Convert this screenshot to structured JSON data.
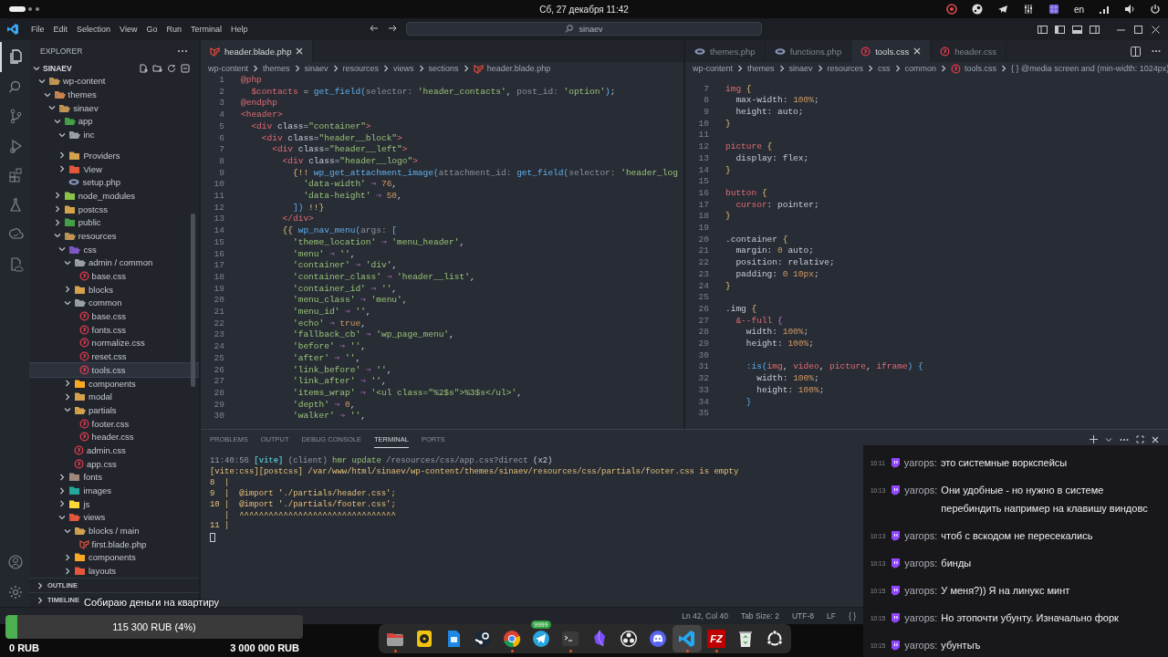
{
  "system_bar": {
    "clock": "Сб, 27 декабря 11:42",
    "keyboard_layout": "en"
  },
  "window": {
    "menu": [
      "File",
      "Edit",
      "Selection",
      "View",
      "Go",
      "Run",
      "Terminal",
      "Help"
    ],
    "command_center": "sinaev"
  },
  "activity_bar": [
    {
      "kind": "explorer",
      "selected": true
    },
    {
      "kind": "search",
      "selected": false
    },
    {
      "kind": "scm",
      "selected": false
    },
    {
      "kind": "debug",
      "selected": false
    },
    {
      "kind": "extensions",
      "selected": false
    },
    {
      "kind": "testing",
      "selected": false
    },
    {
      "kind": "remote",
      "selected": false
    },
    {
      "kind": "docker",
      "selected": false
    },
    {
      "kind": "account",
      "selected": false
    },
    {
      "kind": "settings",
      "selected": false
    }
  ],
  "explorer": {
    "title": "EXPLORER",
    "workspace": "SINAEV",
    "tree": [
      {
        "label": "wp-content",
        "kind": "folder",
        "color": "#c09553",
        "expanded": true,
        "selected": false,
        "children": [
          {
            "label": "themes",
            "kind": "folder",
            "color": "#c9834f",
            "expanded": true,
            "selected": false,
            "children": [
              {
                "label": "sinaev",
                "kind": "folder",
                "color": "#c09553",
                "expanded": true,
                "selected": false,
                "children": [
                  {
                    "label": "app",
                    "kind": "folder",
                    "color": "#43a047",
                    "expanded": true,
                    "selected": false,
                    "children": [
                      {
                        "label": "inc",
                        "kind": "folder",
                        "color": "#9aa0a6",
                        "expanded": true,
                        "selected": false
                      },
                      {
                        "label": "Providers",
                        "kind": "folder",
                        "color": "#d4a24c",
                        "expanded": false,
                        "selected": false
                      },
                      {
                        "label": "View",
                        "kind": "folder",
                        "color": "#e4573d",
                        "expanded": false,
                        "selected": false
                      },
                      {
                        "label": "setup.php",
                        "kind": "php",
                        "selected": false
                      }
                    ]
                  },
                  {
                    "label": "node_modules",
                    "kind": "folder",
                    "color": "#8bc34a",
                    "expanded": false,
                    "selected": false
                  },
                  {
                    "label": "postcss",
                    "kind": "folder",
                    "color": "#d4a24c",
                    "expanded": false,
                    "selected": false
                  },
                  {
                    "label": "public",
                    "kind": "folder",
                    "color": "#43a047",
                    "expanded": false,
                    "selected": false
                  },
                  {
                    "label": "resources",
                    "kind": "folder",
                    "color": "#c09553",
                    "expanded": true,
                    "selected": false,
                    "children": [
                      {
                        "label": "css",
                        "kind": "folder",
                        "color": "#7e57c2",
                        "expanded": true,
                        "selected": false,
                        "children": [
                          {
                            "label": "admin / common",
                            "kind": "folder",
                            "color": "#9aa0a6",
                            "expanded": true,
                            "selected": false,
                            "children": [
                              {
                                "label": "base.css",
                                "kind": "css",
                                "selected": false
                              }
                            ]
                          },
                          {
                            "label": "blocks",
                            "kind": "folder",
                            "color": "#d4a24c",
                            "expanded": false,
                            "selected": false
                          },
                          {
                            "label": "common",
                            "kind": "folder",
                            "color": "#9aa0a6",
                            "expanded": true,
                            "selected": false,
                            "children": [
                              {
                                "label": "base.css",
                                "kind": "css",
                                "selected": false
                              },
                              {
                                "label": "fonts.css",
                                "kind": "css",
                                "selected": false
                              },
                              {
                                "label": "normalize.css",
                                "kind": "css",
                                "selected": false
                              },
                              {
                                "label": "reset.css",
                                "kind": "css",
                                "selected": false
                              },
                              {
                                "label": "tools.css",
                                "kind": "css",
                                "selected": true
                              }
                            ]
                          },
                          {
                            "label": "components",
                            "kind": "folder",
                            "color": "#f9a825",
                            "expanded": false,
                            "selected": false
                          },
                          {
                            "label": "modal",
                            "kind": "folder",
                            "color": "#d4a24c",
                            "expanded": false,
                            "selected": false
                          },
                          {
                            "label": "partials",
                            "kind": "folder",
                            "color": "#d4a24c",
                            "expanded": true,
                            "selected": false,
                            "children": [
                              {
                                "label": "footer.css",
                                "kind": "css",
                                "selected": false
                              },
                              {
                                "label": "header.css",
                                "kind": "css",
                                "selected": false
                              }
                            ]
                          },
                          {
                            "label": "admin.css",
                            "kind": "css",
                            "selected": false
                          },
                          {
                            "label": "app.css",
                            "kind": "css",
                            "selected": false
                          }
                        ]
                      },
                      {
                        "label": "fonts",
                        "kind": "folder",
                        "color": "#a1887f",
                        "expanded": false,
                        "selected": false
                      },
                      {
                        "label": "images",
                        "kind": "folder",
                        "color": "#26a69a",
                        "expanded": false,
                        "selected": false
                      },
                      {
                        "label": "js",
                        "kind": "folder",
                        "color": "#fdd835",
                        "expanded": false,
                        "selected": false
                      },
                      {
                        "label": "views",
                        "kind": "folder",
                        "color": "#e4573d",
                        "expanded": true,
                        "selected": false,
                        "children": [
                          {
                            "label": "blocks / main",
                            "kind": "folder",
                            "color": "#d4a24c",
                            "expanded": true,
                            "selected": false,
                            "children": [
                              {
                                "label": "first.blade.php",
                                "kind": "blade",
                                "selected": false
                              }
                            ]
                          },
                          {
                            "label": "components",
                            "kind": "folder",
                            "color": "#f9a825",
                            "expanded": false,
                            "selected": false
                          },
                          {
                            "label": "layouts",
                            "kind": "folder",
                            "color": "#e4573d",
                            "expanded": false,
                            "selected": false
                          }
                        ]
                      }
                    ]
                  }
                ]
              }
            ]
          }
        ]
      }
    ],
    "sections": [
      {
        "label": "OUTLINE",
        "expanded": false
      },
      {
        "label": "TIMELINE",
        "expanded": false
      }
    ]
  },
  "editors": [
    {
      "tabs": [
        {
          "label": "header.blade.php",
          "kind": "blade",
          "selected": true
        }
      ],
      "breadcrumbs": [
        {
          "label": "wp-content",
          "kind": "dir"
        },
        {
          "label": "themes",
          "kind": "dir"
        },
        {
          "label": "sinaev",
          "kind": "dir"
        },
        {
          "label": "resources",
          "kind": "dir"
        },
        {
          "label": "views",
          "kind": "dir"
        },
        {
          "label": "sections",
          "kind": "dir"
        },
        {
          "label": "header.blade.php",
          "kind": "blade"
        }
      ],
      "lines": [
        {
          "n": "1",
          "tokens": [
            {
              "kind": "keyword",
              "text": "@php"
            }
          ]
        },
        {
          "n": "2",
          "tokens": [
            {
              "kind": "keyword",
              "text": "  $contacts"
            },
            {
              "kind": "plain",
              "text": " = "
            },
            {
              "kind": "call",
              "text": "get_field("
            },
            {
              "kind": "hint",
              "text": "selector: "
            },
            {
              "kind": "string",
              "text": "'header_contacts'"
            },
            {
              "kind": "plain",
              "text": ", "
            },
            {
              "kind": "hint",
              "text": "post_id: "
            },
            {
              "kind": "string",
              "text": "'option'"
            },
            {
              "kind": "call",
              "text": ")"
            },
            {
              "kind": "plain",
              "text": ";"
            }
          ]
        },
        {
          "n": "3",
          "tokens": [
            {
              "kind": "keyword",
              "text": "@endphp"
            }
          ]
        },
        {
          "n": "4",
          "tokens": [
            {
              "kind": "keyword",
              "text": "<header>"
            }
          ]
        },
        {
          "n": "5",
          "tokens": [
            {
              "kind": "keyword",
              "text": "  <div "
            },
            {
              "kind": "plain",
              "text": "class="
            },
            {
              "kind": "string",
              "text": "\"container\""
            },
            {
              "kind": "keyword",
              "text": ">"
            }
          ]
        },
        {
          "n": "6",
          "tokens": [
            {
              "kind": "keyword",
              "text": "    <div "
            },
            {
              "kind": "plain",
              "text": "class="
            },
            {
              "kind": "string",
              "text": "\"header__block\""
            },
            {
              "kind": "keyword",
              "text": ">"
            }
          ]
        },
        {
          "n": "7",
          "tokens": [
            {
              "kind": "keyword",
              "text": "      <div "
            },
            {
              "kind": "plain",
              "text": "class="
            },
            {
              "kind": "string",
              "text": "\"header__left\""
            },
            {
              "kind": "keyword",
              "text": ">"
            }
          ]
        },
        {
          "n": "8",
          "tokens": [
            {
              "kind": "keyword",
              "text": "        <div "
            },
            {
              "kind": "plain",
              "text": "class="
            },
            {
              "kind": "string",
              "text": "\"header__logo\""
            },
            {
              "kind": "keyword",
              "text": ">"
            }
          ]
        },
        {
          "n": "9",
          "tokens": [
            {
              "kind": "brace",
              "text": "          {!! "
            },
            {
              "kind": "call",
              "text": "wp_get_attachment_image("
            },
            {
              "kind": "hint",
              "text": "attachment_id: "
            },
            {
              "kind": "call",
              "text": "get_field("
            },
            {
              "kind": "hint",
              "text": "selector: "
            },
            {
              "kind": "string",
              "text": "'header_log"
            }
          ]
        },
        {
          "n": "10",
          "tokens": [
            {
              "kind": "string",
              "text": "            'data-width'"
            },
            {
              "kind": "operator",
              "text": " ⇒ "
            },
            {
              "kind": "number",
              "text": "76"
            },
            {
              "kind": "plain",
              "text": ","
            }
          ]
        },
        {
          "n": "11",
          "tokens": [
            {
              "kind": "string",
              "text": "            'data-height'"
            },
            {
              "kind": "operator",
              "text": " ⇒ "
            },
            {
              "kind": "number",
              "text": "50"
            },
            {
              "kind": "plain",
              "text": ","
            }
          ]
        },
        {
          "n": "12",
          "tokens": [
            {
              "kind": "call",
              "text": "          ])"
            },
            {
              "kind": "brace",
              "text": " !!}"
            }
          ]
        },
        {
          "n": "13",
          "tokens": [
            {
              "kind": "keyword",
              "text": "        </div>"
            }
          ]
        },
        {
          "n": "14",
          "tokens": [
            {
              "kind": "brace",
              "text": "        {{ "
            },
            {
              "kind": "call",
              "text": "wp_nav_menu("
            },
            {
              "kind": "hint",
              "text": "args: "
            },
            {
              "kind": "call",
              "text": "["
            }
          ]
        },
        {
          "n": "15",
          "tokens": [
            {
              "kind": "string",
              "text": "          'theme_location'"
            },
            {
              "kind": "operator",
              "text": " ⇒ "
            },
            {
              "kind": "string",
              "text": "'menu_header'"
            },
            {
              "kind": "plain",
              "text": ","
            }
          ]
        },
        {
          "n": "16",
          "tokens": [
            {
              "kind": "string",
              "text": "          'menu'"
            },
            {
              "kind": "operator",
              "text": " ⇒ "
            },
            {
              "kind": "string",
              "text": "''"
            },
            {
              "kind": "plain",
              "text": ","
            }
          ]
        },
        {
          "n": "17",
          "tokens": [
            {
              "kind": "string",
              "text": "          'container'"
            },
            {
              "kind": "operator",
              "text": " ⇒ "
            },
            {
              "kind": "string",
              "text": "'div'"
            },
            {
              "kind": "plain",
              "text": ","
            }
          ]
        },
        {
          "n": "18",
          "tokens": [
            {
              "kind": "string",
              "text": "          'container_class'"
            },
            {
              "kind": "operator",
              "text": " ⇒ "
            },
            {
              "kind": "string",
              "text": "'header__list'"
            },
            {
              "kind": "plain",
              "text": ","
            }
          ]
        },
        {
          "n": "19",
          "tokens": [
            {
              "kind": "string",
              "text": "          'container_id'"
            },
            {
              "kind": "operator",
              "text": " ⇒ "
            },
            {
              "kind": "string",
              "text": "''"
            },
            {
              "kind": "plain",
              "text": ","
            }
          ]
        },
        {
          "n": "20",
          "tokens": [
            {
              "kind": "string",
              "text": "          'menu_class'"
            },
            {
              "kind": "operator",
              "text": " ⇒ "
            },
            {
              "kind": "string",
              "text": "'menu'"
            },
            {
              "kind": "plain",
              "text": ","
            }
          ]
        },
        {
          "n": "21",
          "tokens": [
            {
              "kind": "string",
              "text": "          'menu_id'"
            },
            {
              "kind": "operator",
              "text": " ⇒ "
            },
            {
              "kind": "string",
              "text": "''"
            },
            {
              "kind": "plain",
              "text": ","
            }
          ]
        },
        {
          "n": "22",
          "tokens": [
            {
              "kind": "string",
              "text": "          'echo'"
            },
            {
              "kind": "operator",
              "text": " ⇒ "
            },
            {
              "kind": "number",
              "text": "true"
            },
            {
              "kind": "plain",
              "text": ","
            }
          ]
        },
        {
          "n": "23",
          "tokens": [
            {
              "kind": "string",
              "text": "          'fallback_cb'"
            },
            {
              "kind": "operator",
              "text": " ⇒ "
            },
            {
              "kind": "string",
              "text": "'wp_page_menu'"
            },
            {
              "kind": "plain",
              "text": ","
            }
          ]
        },
        {
          "n": "24",
          "tokens": [
            {
              "kind": "string",
              "text": "          'before'"
            },
            {
              "kind": "operator",
              "text": " ⇒ "
            },
            {
              "kind": "string",
              "text": "''"
            },
            {
              "kind": "plain",
              "text": ","
            }
          ]
        },
        {
          "n": "25",
          "tokens": [
            {
              "kind": "string",
              "text": "          'after'"
            },
            {
              "kind": "operator",
              "text": " ⇒ "
            },
            {
              "kind": "string",
              "text": "''"
            },
            {
              "kind": "plain",
              "text": ","
            }
          ]
        },
        {
          "n": "26",
          "tokens": [
            {
              "kind": "string",
              "text": "          'link_before'"
            },
            {
              "kind": "operator",
              "text": " ⇒ "
            },
            {
              "kind": "string",
              "text": "''"
            },
            {
              "kind": "plain",
              "text": ","
            }
          ]
        },
        {
          "n": "27",
          "tokens": [
            {
              "kind": "string",
              "text": "          'link_after'"
            },
            {
              "kind": "operator",
              "text": " ⇒ "
            },
            {
              "kind": "string",
              "text": "''"
            },
            {
              "kind": "plain",
              "text": ","
            }
          ]
        },
        {
          "n": "28",
          "tokens": [
            {
              "kind": "string",
              "text": "          'items_wrap'"
            },
            {
              "kind": "operator",
              "text": " ⇒ "
            },
            {
              "kind": "string",
              "text": "'<ul class=\"%2$s\">%3$s</ul>'"
            },
            {
              "kind": "plain",
              "text": ","
            }
          ]
        },
        {
          "n": "29",
          "tokens": [
            {
              "kind": "string",
              "text": "          'depth'"
            },
            {
              "kind": "operator",
              "text": " ⇒ "
            },
            {
              "kind": "number",
              "text": "0"
            },
            {
              "kind": "plain",
              "text": ","
            }
          ]
        },
        {
          "n": "30",
          "tokens": [
            {
              "kind": "string",
              "text": "          'walker'"
            },
            {
              "kind": "operator",
              "text": " ⇒ "
            },
            {
              "kind": "string",
              "text": "''"
            },
            {
              "kind": "plain",
              "text": ","
            }
          ]
        }
      ]
    },
    {
      "tabs": [
        {
          "label": "themes.php",
          "kind": "php",
          "selected": false
        },
        {
          "label": "functions.php",
          "kind": "php",
          "selected": false
        },
        {
          "label": "tools.css",
          "kind": "css",
          "selected": true
        },
        {
          "label": "header.css",
          "kind": "css",
          "selected": false
        }
      ],
      "breadcrumbs": [
        {
          "label": "wp-content",
          "kind": "dir"
        },
        {
          "label": "themes",
          "kind": "dir"
        },
        {
          "label": "sinaev",
          "kind": "dir"
        },
        {
          "label": "resources",
          "kind": "dir"
        },
        {
          "label": "css",
          "kind": "dir"
        },
        {
          "label": "common",
          "kind": "dir"
        },
        {
          "label": "tools.css",
          "kind": "css"
        },
        {
          "label": "{ } @media screen and (min-width: 1024px)",
          "kind": "symbol"
        }
      ],
      "lines": [
        {
          "n": "7",
          "tokens": [
            {
              "kind": "keyword",
              "text": "img "
            },
            {
              "kind": "brace",
              "text": "{"
            }
          ]
        },
        {
          "n": "8",
          "tokens": [
            {
              "kind": "plain",
              "text": "  max-width: "
            },
            {
              "kind": "number",
              "text": "100%"
            },
            {
              "kind": "plain",
              "text": ";"
            }
          ]
        },
        {
          "n": "9",
          "tokens": [
            {
              "kind": "plain",
              "text": "  height: auto;"
            }
          ]
        },
        {
          "n": "10",
          "tokens": [
            {
              "kind": "brace",
              "text": "}"
            }
          ]
        },
        {
          "n": "11"
        },
        {
          "n": "12",
          "tokens": [
            {
              "kind": "keyword",
              "text": "picture "
            },
            {
              "kind": "brace",
              "text": "{"
            }
          ]
        },
        {
          "n": "13",
          "tokens": [
            {
              "kind": "plain",
              "text": "  display: flex;"
            }
          ]
        },
        {
          "n": "14",
          "tokens": [
            {
              "kind": "brace",
              "text": "}"
            }
          ]
        },
        {
          "n": "15"
        },
        {
          "n": "16",
          "tokens": [
            {
              "kind": "keyword",
              "text": "button "
            },
            {
              "kind": "brace",
              "text": "{"
            }
          ]
        },
        {
          "n": "17",
          "tokens": [
            {
              "kind": "keyword",
              "text": "  cursor"
            },
            {
              "kind": "plain",
              "text": ": pointer;"
            }
          ]
        },
        {
          "n": "18",
          "tokens": [
            {
              "kind": "brace",
              "text": "}"
            }
          ]
        },
        {
          "n": "19"
        },
        {
          "n": "20",
          "tokens": [
            {
              "kind": "plain",
              "text": ".container "
            },
            {
              "kind": "brace",
              "text": "{"
            }
          ]
        },
        {
          "n": "21",
          "tokens": [
            {
              "kind": "plain",
              "text": "  margin: "
            },
            {
              "kind": "number",
              "text": "0"
            },
            {
              "kind": "plain",
              "text": " auto;"
            }
          ]
        },
        {
          "n": "22",
          "tokens": [
            {
              "kind": "plain",
              "text": "  position: relative;"
            }
          ]
        },
        {
          "n": "23",
          "tokens": [
            {
              "kind": "plain",
              "text": "  padding: "
            },
            {
              "kind": "number",
              "text": "0 10px"
            },
            {
              "kind": "plain",
              "text": ";"
            }
          ]
        },
        {
          "n": "24",
          "tokens": [
            {
              "kind": "brace",
              "text": "}"
            }
          ]
        },
        {
          "n": "25"
        },
        {
          "n": "26",
          "tokens": [
            {
              "kind": "plain",
              "text": ".img "
            },
            {
              "kind": "brace",
              "text": "{"
            }
          ]
        },
        {
          "n": "27",
          "tokens": [
            {
              "kind": "keyword",
              "text": "  &--full "
            },
            {
              "kind": "operator",
              "text": "{"
            }
          ]
        },
        {
          "n": "28",
          "tokens": [
            {
              "kind": "plain",
              "text": "    width: "
            },
            {
              "kind": "number",
              "text": "100%"
            },
            {
              "kind": "plain",
              "text": ";"
            }
          ]
        },
        {
          "n": "29",
          "tokens": [
            {
              "kind": "plain",
              "text": "    height: "
            },
            {
              "kind": "number",
              "text": "100%"
            },
            {
              "kind": "plain",
              "text": ";"
            }
          ]
        },
        {
          "n": "30"
        },
        {
          "n": "31",
          "tokens": [
            {
              "kind": "call",
              "text": "    :is("
            },
            {
              "kind": "keyword",
              "text": "img"
            },
            {
              "kind": "plain",
              "text": ", "
            },
            {
              "kind": "keyword",
              "text": "video"
            },
            {
              "kind": "plain",
              "text": ", "
            },
            {
              "kind": "keyword",
              "text": "picture"
            },
            {
              "kind": "plain",
              "text": ", "
            },
            {
              "kind": "keyword",
              "text": "iframe"
            },
            {
              "kind": "call",
              "text": ") {"
            }
          ]
        },
        {
          "n": "32",
          "tokens": [
            {
              "kind": "plain",
              "text": "      width: "
            },
            {
              "kind": "number",
              "text": "100%"
            },
            {
              "kind": "plain",
              "text": ";"
            }
          ]
        },
        {
          "n": "33",
          "tokens": [
            {
              "kind": "plain",
              "text": "      height: "
            },
            {
              "kind": "number",
              "text": "100%"
            },
            {
              "kind": "plain",
              "text": ";"
            }
          ]
        },
        {
          "n": "34",
          "tokens": [
            {
              "kind": "call",
              "text": "    }"
            }
          ]
        },
        {
          "n": "35"
        }
      ]
    }
  ],
  "panel": {
    "tabs": [
      {
        "label": "PROBLEMS",
        "selected": false
      },
      {
        "label": "OUTPUT",
        "selected": false
      },
      {
        "label": "DEBUG CONSOLE",
        "selected": false
      },
      {
        "label": "TERMINAL",
        "selected": true
      },
      {
        "label": "PORTS",
        "selected": false
      }
    ],
    "terminal": [
      [
        {
          "kind": "dim",
          "text": "11:40:56 "
        },
        {
          "kind": "label",
          "text": "[vite]"
        },
        {
          "kind": "dim",
          "text": " (client)"
        },
        {
          "kind": "success",
          "text": " hmr update"
        },
        {
          "kind": "dim",
          "text": " /resources/css/app.css?direct"
        },
        {
          "kind": "plain",
          "text": " (x2)"
        }
      ],
      [
        {
          "kind": "warning",
          "text": "[vite:css][postcss] /var/www/html/sinaev/wp-content/themes/sinaev/resources/css/partials/footer.css is empty"
        }
      ],
      [
        {
          "kind": "warning",
          "text": "8  |"
        }
      ],
      [
        {
          "kind": "warning",
          "text": "9  |  @import './partials/header.css';"
        }
      ],
      [
        {
          "kind": "warning",
          "text": "10 |  @import './partials/footer.css';"
        }
      ],
      [
        {
          "kind": "warning",
          "text": "   |  ^^^^^^^^^^^^^^^^^^^^^^^^^^^^^^^^"
        }
      ],
      [
        {
          "kind": "warning",
          "text": "11 |"
        }
      ]
    ]
  },
  "status_bar": [
    "Ln 42, Col 40",
    "Tab Size: 2",
    "UTF-8",
    "LF",
    "{ }"
  ],
  "donation": {
    "title": "Собираю деньги на квартиру",
    "level": 0.04,
    "amount": "115 300 RUB (4%)",
    "start": "0 RUB",
    "goal": "3 000 000 RUB"
  },
  "dock": [
    {
      "kind": "files",
      "running": true,
      "selected": false
    },
    {
      "kind": "music",
      "running": false,
      "selected": false
    },
    {
      "kind": "office",
      "running": false,
      "selected": false
    },
    {
      "kind": "steam",
      "running": false,
      "selected": false
    },
    {
      "kind": "browser",
      "running": true,
      "selected": false
    },
    {
      "kind": "messenger",
      "running": false,
      "selected": false,
      "badge": "9999"
    },
    {
      "kind": "terminal",
      "running": true,
      "selected": false
    },
    {
      "kind": "notes",
      "running": false,
      "selected": false
    },
    {
      "kind": "recorder",
      "running": false,
      "selected": false
    },
    {
      "kind": "voice",
      "running": false,
      "selected": false
    },
    {
      "kind": "editor",
      "running": true,
      "selected": true
    },
    {
      "kind": "ftp",
      "running": true,
      "selected": false,
      "logo": "FZ"
    },
    {
      "kind": "trash",
      "running": false,
      "selected": false
    },
    {
      "kind": "apps",
      "running": false,
      "selected": false
    }
  ],
  "chat": [
    {
      "time": "10:11",
      "user": "yarops:",
      "text": "это системные воркспейсы"
    },
    {
      "time": "10:13",
      "user": "yarops:",
      "text": "Они удобные - но нужно в системе перебиндить например на клавишу виндовс"
    },
    {
      "time": "10:13",
      "user": "yarops:",
      "text": "чтоб с вскодом не пересекались"
    },
    {
      "time": "10:13",
      "user": "yarops:",
      "text": "бинды"
    },
    {
      "time": "10:15",
      "user": "yarops:",
      "text": "У меня?)) Я на линукс минт"
    },
    {
      "time": "10:15",
      "user": "yarops:",
      "text": "Но этопочти убунту. Изначально форк"
    },
    {
      "time": "10:15",
      "user": "yarops:",
      "text": "убунтыъ"
    }
  ]
}
